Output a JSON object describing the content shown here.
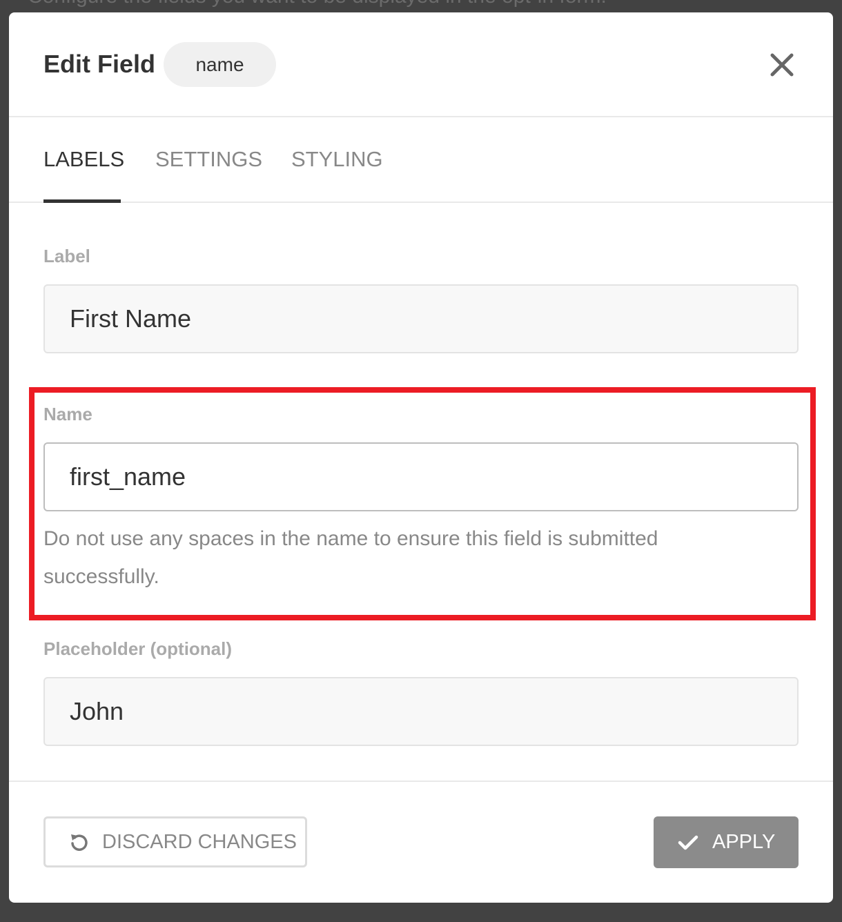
{
  "background": {
    "text": "Configure the fields you want to be displayed in the opt-in form."
  },
  "modal": {
    "title": "Edit Field",
    "field_type_badge": "name"
  },
  "tabs": [
    {
      "label": "LABELS",
      "active": true
    },
    {
      "label": "SETTINGS",
      "active": false
    },
    {
      "label": "STYLING",
      "active": false
    }
  ],
  "fields": {
    "label": {
      "label": "Label",
      "value": "First Name"
    },
    "name": {
      "label": "Name",
      "value": "first_name",
      "help": "Do not use any spaces in the name to ensure this field is submitted successfully."
    },
    "placeholder": {
      "label": "Placeholder (optional)",
      "value": "John"
    }
  },
  "footer": {
    "discard_label": "DISCARD CHANGES",
    "apply_label": "APPLY"
  },
  "colors": {
    "highlight": "#ec1c24",
    "apply_button": "#8b8b8b",
    "overlay": "#424242"
  },
  "icons": {
    "close": "close-icon",
    "discard": "undo-icon",
    "apply": "check-icon"
  }
}
